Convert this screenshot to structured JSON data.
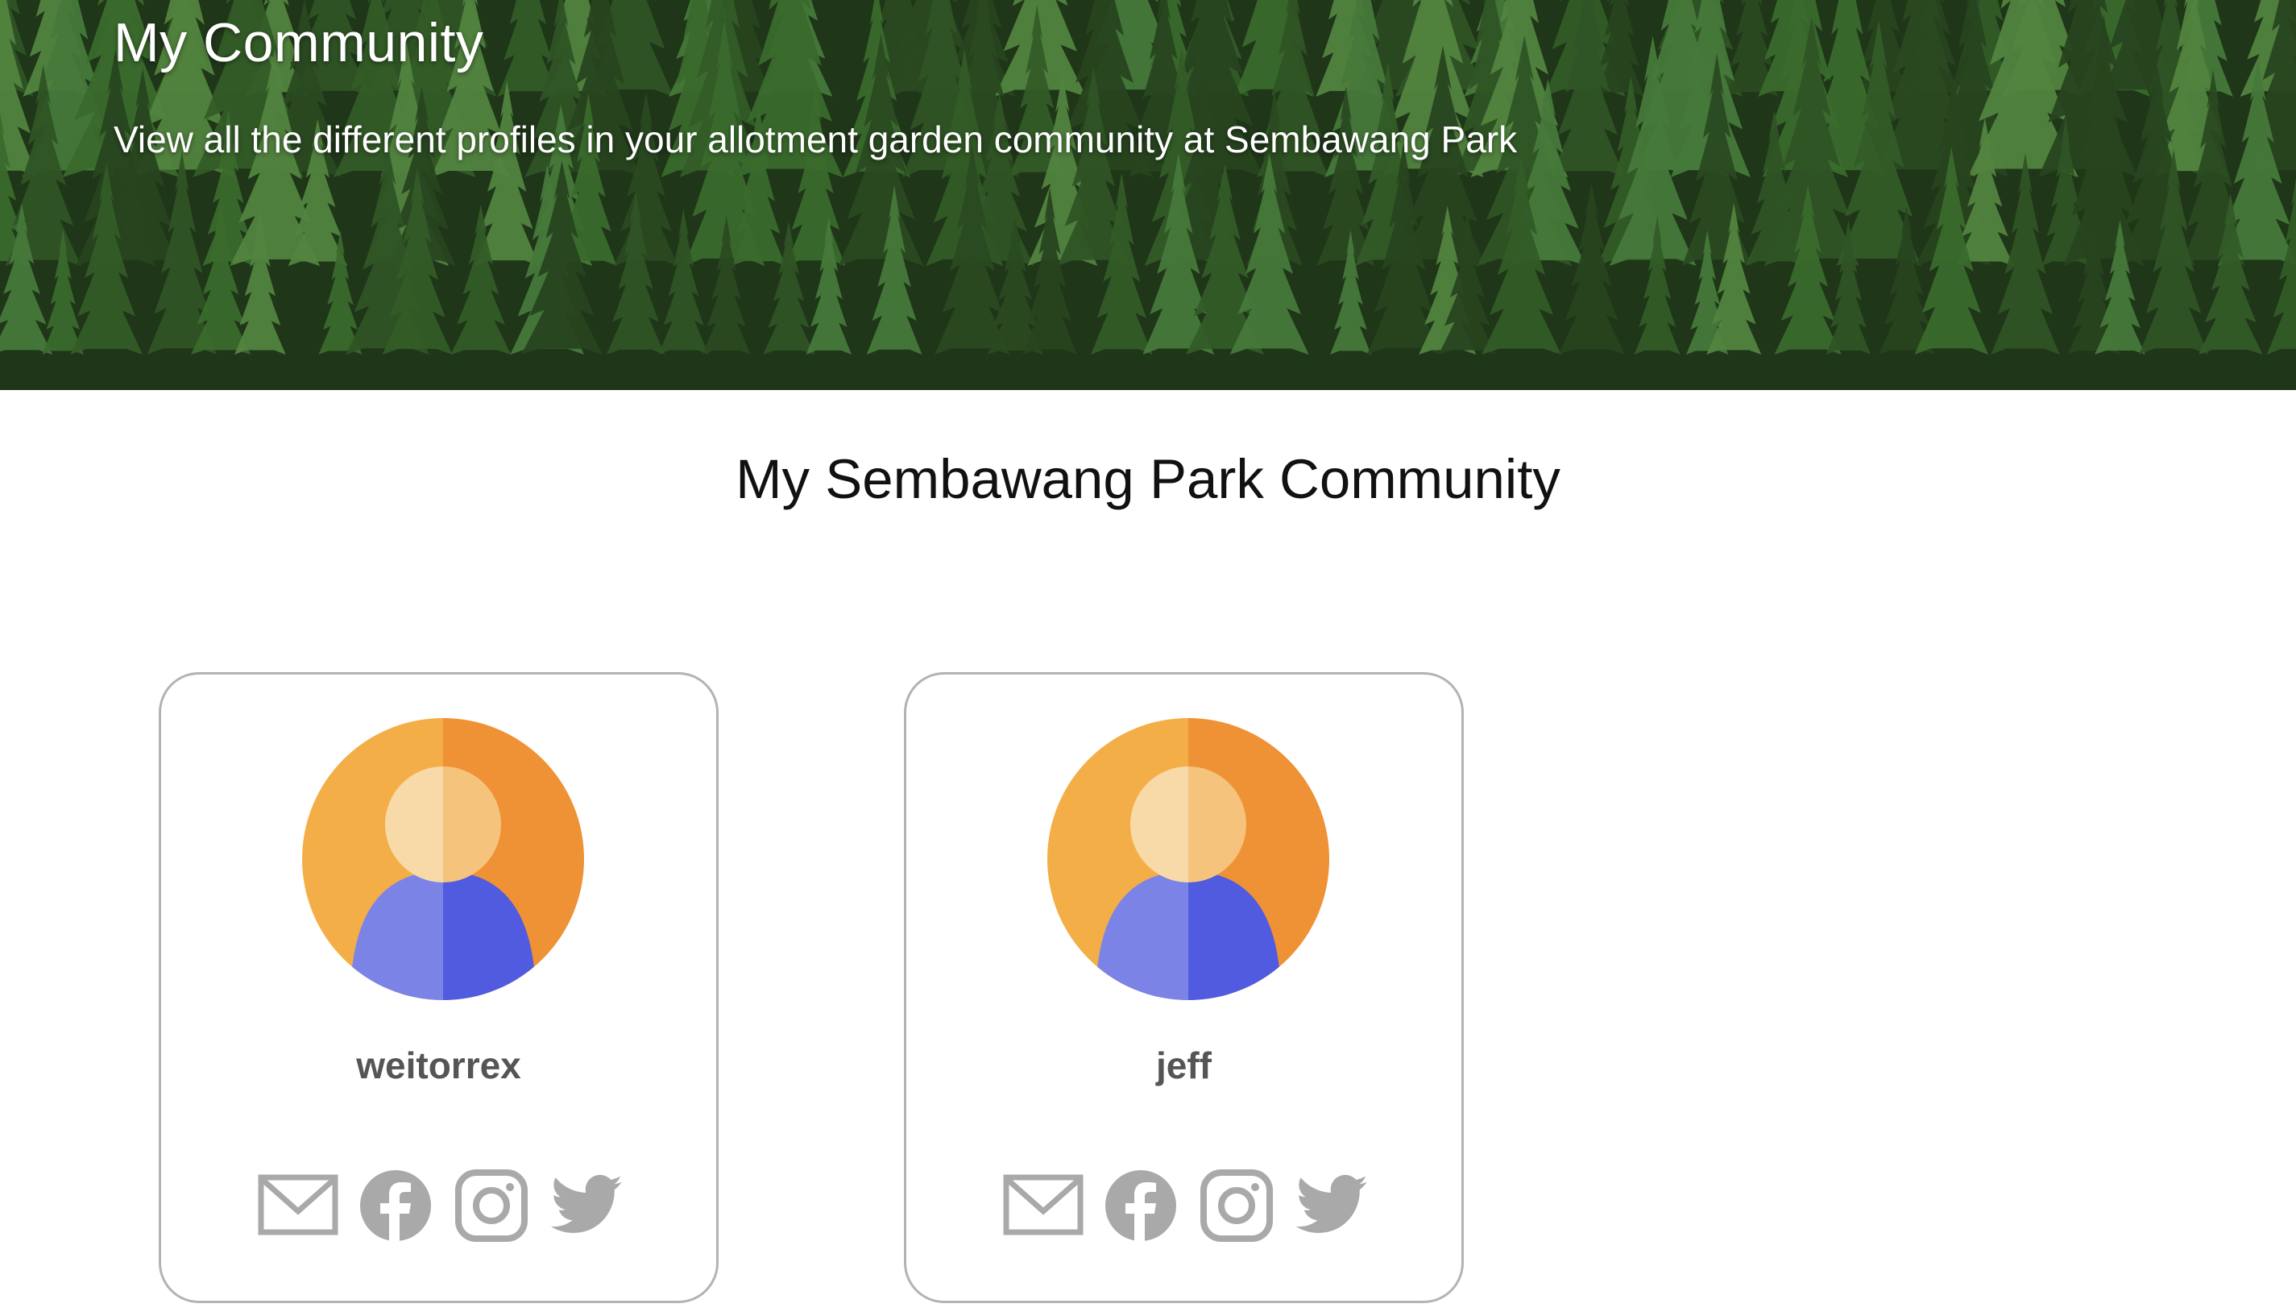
{
  "hero": {
    "title": "My Community",
    "subtitle": "View all the different profiles in your allotment garden community at Sembawang Park"
  },
  "section": {
    "title": "My Sembawang Park Community"
  },
  "profiles": [
    {
      "username": "weitorrex"
    },
    {
      "username": "jeff"
    }
  ],
  "socials": [
    "mail-icon",
    "facebook-icon",
    "instagram-icon",
    "twitter-icon"
  ],
  "colors": {
    "forest_dark": "#1c3317",
    "forest_light": "#4d7a35",
    "avatar_left": "#f3ae47",
    "avatar_right": "#ef9135",
    "face_left": "#f8d9a8",
    "face_right": "#f5c37b",
    "body_left": "#7b83e6",
    "body_right": "#505be0",
    "icon_gray": "#a9a9a9",
    "card_border": "#b3b3b3",
    "username": "#555555"
  }
}
